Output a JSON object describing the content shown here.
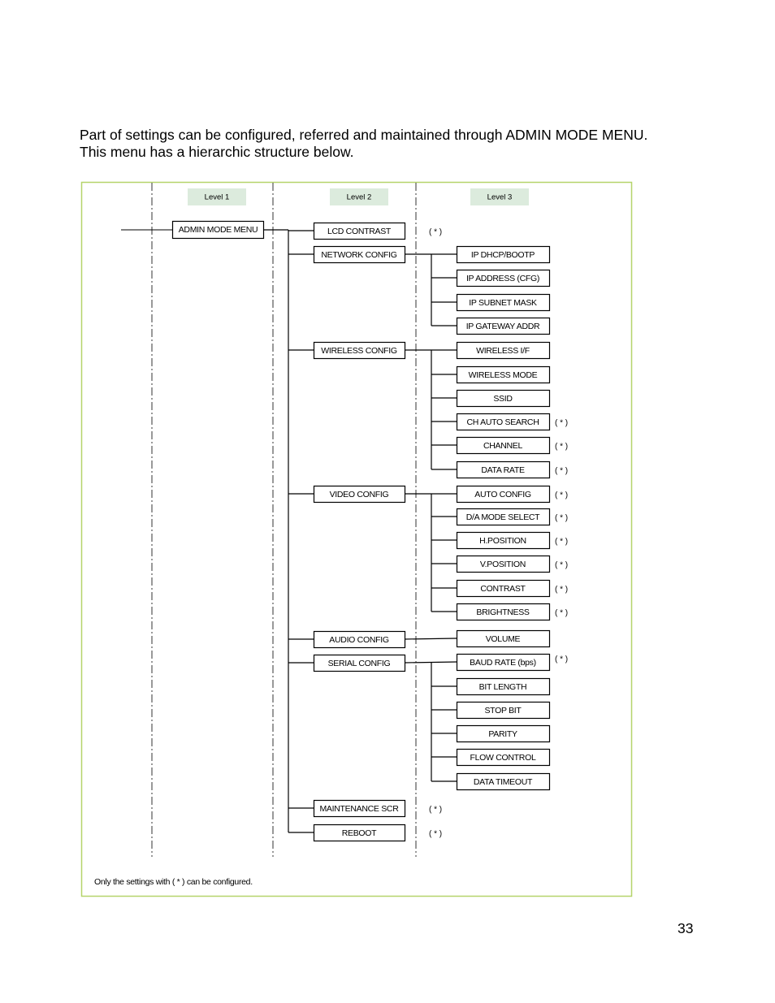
{
  "intro": {
    "line1": "Part of settings can be configured, referred and maintained through ADMIN MODE MENU.",
    "line2": "This menu has a hierarchic structure below."
  },
  "diagram": {
    "frame_color": "#b5d46a",
    "level_header_color": "#dcebdd",
    "levels": [
      "Level 1",
      "Level 2",
      "Level 3"
    ],
    "configurable_marker": "( * )",
    "note": "Only the settings with ( * ) can be configured.",
    "root": "ADMIN MODE MENU",
    "level2": [
      {
        "label": "LCD CONTRAST",
        "configurable": true,
        "children": []
      },
      {
        "label": "NETWORK CONFIG",
        "configurable": false,
        "children": [
          {
            "label": "IP DHCP/BOOTP",
            "configurable": false
          },
          {
            "label": "IP ADDRESS (CFG)",
            "configurable": false
          },
          {
            "label": "IP SUBNET MASK",
            "configurable": false
          },
          {
            "label": "IP GATEWAY ADDR",
            "configurable": false
          }
        ]
      },
      {
        "label": "WIRELESS CONFIG",
        "configurable": false,
        "children": [
          {
            "label": "WIRELESS I/F",
            "configurable": false
          },
          {
            "label": "WIRELESS MODE",
            "configurable": false
          },
          {
            "label": "SSID",
            "configurable": false
          },
          {
            "label": "CH AUTO SEARCH",
            "configurable": true
          },
          {
            "label": "CHANNEL",
            "configurable": true
          },
          {
            "label": "DATA RATE",
            "configurable": true
          }
        ]
      },
      {
        "label": "VIDEO CONFIG",
        "configurable": false,
        "children": [
          {
            "label": "AUTO CONFIG",
            "configurable": true
          },
          {
            "label": "D/A MODE SELECT",
            "configurable": true
          },
          {
            "label": "H.POSITION",
            "configurable": true
          },
          {
            "label": "V.POSITION",
            "configurable": true
          },
          {
            "label": "CONTRAST",
            "configurable": true
          },
          {
            "label": "BRIGHTNESS",
            "configurable": true
          }
        ]
      },
      {
        "label": "AUDIO CONFIG",
        "configurable": false,
        "children": [
          {
            "label": "VOLUME",
            "configurable": false
          }
        ]
      },
      {
        "label": "SERIAL CONFIG",
        "configurable": false,
        "children": [
          {
            "label": "BAUD RATE (bps)",
            "configurable": true
          },
          {
            "label": "BIT LENGTH",
            "configurable": false
          },
          {
            "label": "STOP BIT",
            "configurable": false
          },
          {
            "label": "PARITY",
            "configurable": false
          },
          {
            "label": "FLOW CONTROL",
            "configurable": false
          },
          {
            "label": "DATA TIMEOUT",
            "configurable": false
          }
        ]
      },
      {
        "label": "MAINTENANCE SCR",
        "configurable": true,
        "children": []
      },
      {
        "label": "REBOOT",
        "configurable": true,
        "children": []
      }
    ]
  },
  "page_number": "33"
}
